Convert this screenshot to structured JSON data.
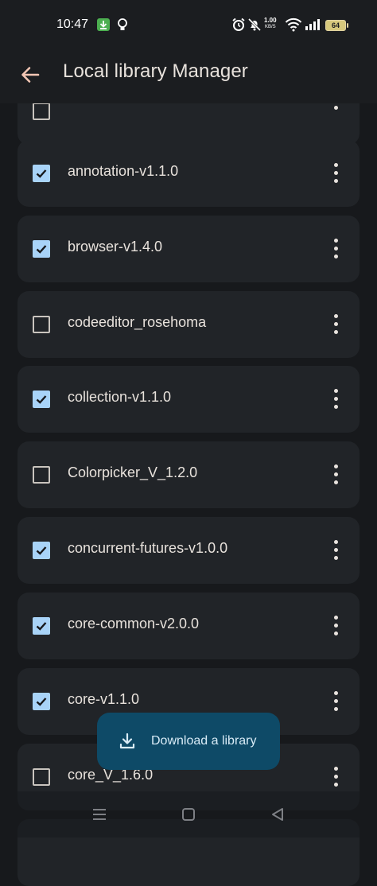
{
  "status_bar": {
    "time": "10:47",
    "net_speed_value": "1.00",
    "net_speed_unit": "KB/S",
    "battery": "64",
    "icons": [
      "download-notification-icon",
      "lightbulb-icon",
      "alarm-icon",
      "mute-icon",
      "wifi-icon",
      "signal-icon",
      "battery-icon"
    ]
  },
  "app_bar": {
    "title": "Local library Manager",
    "back_icon": "arrow-back-icon"
  },
  "libraries": [
    {
      "name": "_ _",
      "checked": false
    },
    {
      "name": "annotation-v1.1.0",
      "checked": true
    },
    {
      "name": "browser-v1.4.0",
      "checked": true
    },
    {
      "name": "codeeditor_rosehoma",
      "checked": false
    },
    {
      "name": "collection-v1.1.0",
      "checked": true
    },
    {
      "name": "Colorpicker_V_1.2.0",
      "checked": false
    },
    {
      "name": "concurrent-futures-v1.0.0",
      "checked": true
    },
    {
      "name": "core-common-v2.0.0",
      "checked": true
    },
    {
      "name": "core-v1.1.0",
      "checked": true
    },
    {
      "name": "core_V_1.6.0",
      "checked": false
    }
  ],
  "fab": {
    "label": "Download a library",
    "icon": "download-icon"
  },
  "nav_bar": {
    "icons": [
      "menu-icon",
      "home-square-icon",
      "back-triangle-icon"
    ]
  },
  "colors": {
    "background": "#17191c",
    "card": "#212428",
    "checkbox_checked": "#a8d3f8",
    "fab": "#0e4a67"
  }
}
